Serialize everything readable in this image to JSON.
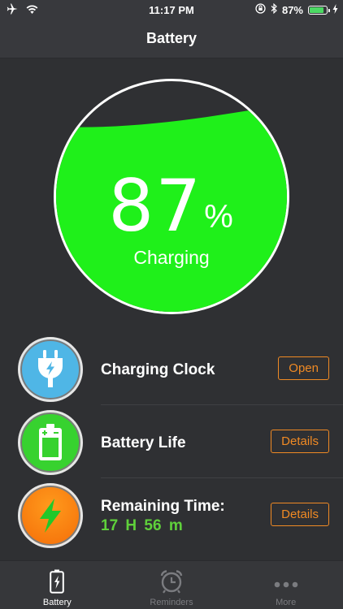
{
  "status_bar": {
    "time": "11:17 PM",
    "battery_percent": "87%",
    "battery_level": 0.87
  },
  "nav": {
    "title": "Battery"
  },
  "gauge": {
    "value": "87",
    "unit": "%",
    "level": 0.87,
    "status": "Charging",
    "fill_color": "#1ff01a"
  },
  "rows": [
    {
      "title": "Charging Clock",
      "button": "Open",
      "icon": "plug-icon",
      "icon_color": "#4fb6e6"
    },
    {
      "title": "Battery Life",
      "button": "Details",
      "icon": "battery-icon",
      "icon_color": "#37d22f"
    },
    {
      "title": "Remaining Time:",
      "subtitle": "17 H  56 m",
      "button": "Details",
      "icon": "lightning-icon",
      "icon_color": "#f5840f"
    }
  ],
  "tabs": [
    {
      "label": "Battery",
      "icon": "battery-tab-icon",
      "active": true
    },
    {
      "label": "Reminders",
      "icon": "alarm-clock-icon",
      "active": false
    },
    {
      "label": "More",
      "icon": "more-dots-icon",
      "active": false
    }
  ],
  "colors": {
    "accent": "#f08a24",
    "background": "#2f3033",
    "green_text": "#5fd03b"
  }
}
